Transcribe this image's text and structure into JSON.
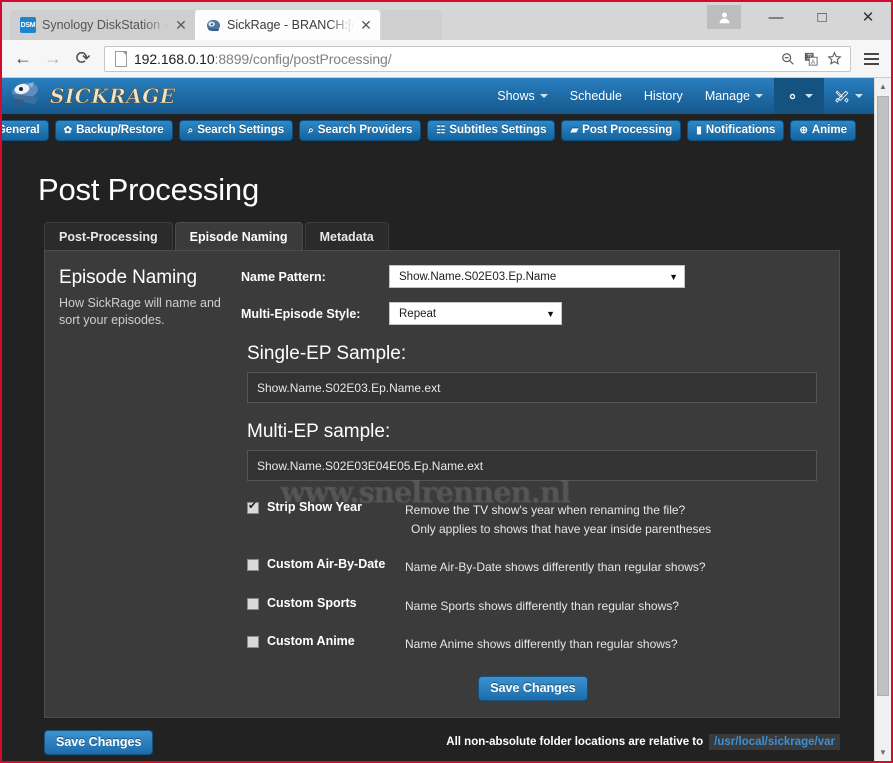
{
  "browser": {
    "tabs": [
      {
        "title": "Synology DiskStation - NA",
        "favicon": "dsm-icon",
        "favicon_text": "DSM",
        "active": false
      },
      {
        "title": "SickRage - BRANCH:[mast",
        "favicon": "sickrage-icon",
        "favicon_text": "",
        "active": true
      }
    ],
    "close_label": "✕",
    "window_controls": {
      "minimize": "—",
      "maximize": "□",
      "close": "✕"
    },
    "nav": {
      "back": "←",
      "forward": "→",
      "reload": "⟳"
    },
    "url": {
      "host": "192.168.0.10",
      "rest": ":8899/config/postProcessing/"
    },
    "omnibox_icons": [
      "zoom-out-icon",
      "translate-icon",
      "bookmark-star-icon"
    ],
    "menu_icon": "hamburger-menu-icon"
  },
  "app": {
    "logo_text": "SICKRAGE",
    "nav_items": [
      {
        "label": "Shows",
        "caret": true,
        "active": false
      },
      {
        "label": "Schedule",
        "caret": false,
        "active": false
      },
      {
        "label": "History",
        "caret": false,
        "active": false
      },
      {
        "label": "Manage",
        "caret": true,
        "active": false
      }
    ],
    "nav_icon_items": [
      {
        "icon": "gear-icon",
        "caret": true,
        "active": true
      },
      {
        "icon": "tools-icon",
        "caret": true,
        "active": false
      }
    ],
    "config_buttons": [
      {
        "label": "General",
        "icon": "gear-icon"
      },
      {
        "label": "Backup/Restore",
        "icon": "gear-icon"
      },
      {
        "label": "Search Settings",
        "icon": "magnifier-icon"
      },
      {
        "label": "Search Providers",
        "icon": "magnifier-icon"
      },
      {
        "label": "Subtitles Settings",
        "icon": "subtitle-icon"
      },
      {
        "label": "Post Processing",
        "icon": "folder-icon"
      },
      {
        "label": "Notifications",
        "icon": "book-icon"
      },
      {
        "label": "Anime",
        "icon": "globe-icon"
      }
    ]
  },
  "page": {
    "title": "Post Processing",
    "tabs": [
      {
        "label": "Post-Processing",
        "active": false
      },
      {
        "label": "Episode Naming",
        "active": true
      },
      {
        "label": "Metadata",
        "active": false
      }
    ],
    "section": {
      "heading": "Episode Naming",
      "description": "How SickRage will name and sort your episodes."
    },
    "fields": [
      {
        "label": "Name Pattern:",
        "value": "Show.Name.S02E03.Ep.Name",
        "control": "select"
      },
      {
        "label": "Multi-Episode Style:",
        "value": "Repeat",
        "control": "select"
      }
    ],
    "samples": [
      {
        "heading": "Single-EP Sample:",
        "value": "Show.Name.S02E03.Ep.Name.ext"
      },
      {
        "heading": "Multi-EP sample:",
        "value": "Show.Name.S02E03E04E05.Ep.Name.ext"
      }
    ],
    "checkboxes": [
      {
        "label": "Strip Show Year",
        "checked": true,
        "desc": "Remove the TV show's year when renaming the file?",
        "sub": "Only applies to shows that have year inside parentheses"
      },
      {
        "label": "Custom Air-By-Date",
        "checked": false,
        "desc": "Name Air-By-Date shows differently than regular shows?",
        "sub": ""
      },
      {
        "label": "Custom Sports",
        "checked": false,
        "desc": "Name Sports shows differently than regular shows?",
        "sub": ""
      },
      {
        "label": "Custom Anime",
        "checked": false,
        "desc": "Name Anime shows differently than regular shows?",
        "sub": ""
      }
    ],
    "panel_save_label": "Save Changes",
    "footer_save_label": "Save Changes",
    "footer_note": "All non-absolute folder locations are relative to",
    "footer_path": "/usr/local/sickrage/var",
    "watermark": "www.snelrennen.nl"
  },
  "colors": {
    "brand_blue": "#1f6ba5",
    "button_blue": "#2d88c8",
    "page_bg": "#222222",
    "panel_bg": "#3b3b3b",
    "link_blue": "#3d8fd6"
  }
}
